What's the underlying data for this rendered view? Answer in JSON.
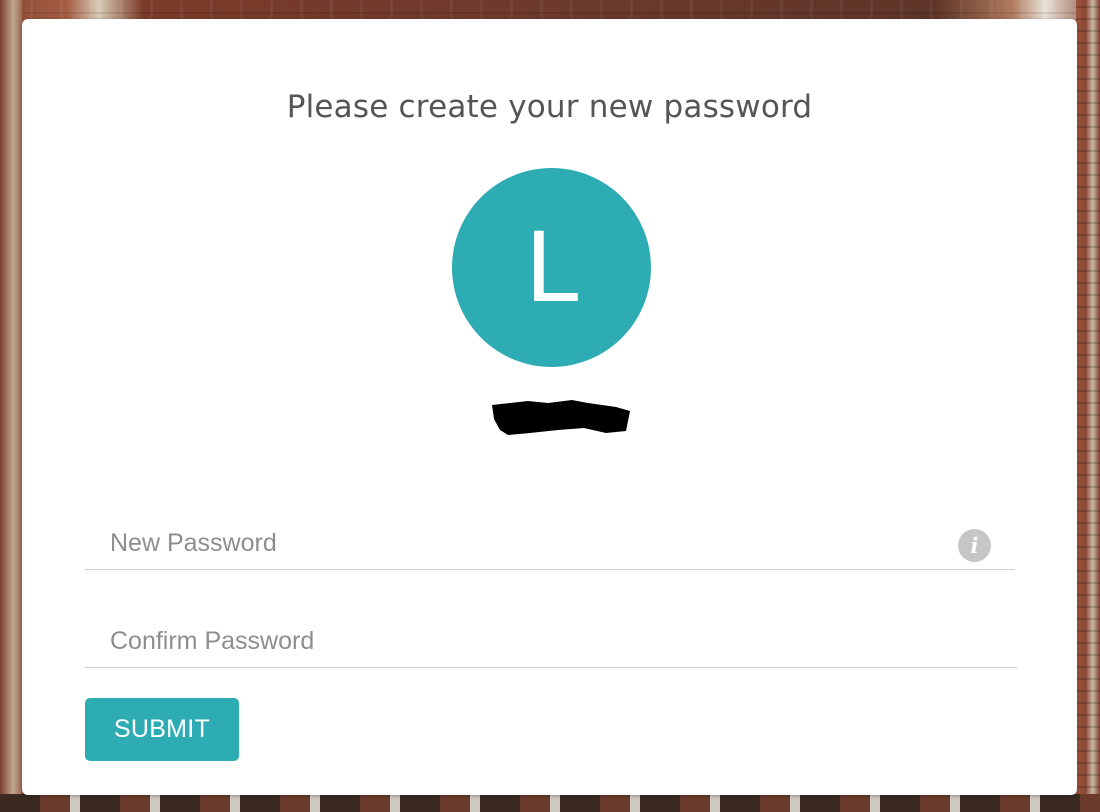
{
  "page": {
    "title": "Please create your new password"
  },
  "avatar": {
    "initial": "L",
    "color": "#2eacb3"
  },
  "form": {
    "new_password": {
      "placeholder": "New Password",
      "value": "",
      "info_icon": "info-icon"
    },
    "confirm_password": {
      "placeholder": "Confirm Password",
      "value": ""
    },
    "submit_label": "SUBMIT"
  },
  "colors": {
    "accent": "#2eacb3",
    "title_text": "#555555",
    "placeholder": "#8e8e8e",
    "underline": "#cfcfcf"
  }
}
